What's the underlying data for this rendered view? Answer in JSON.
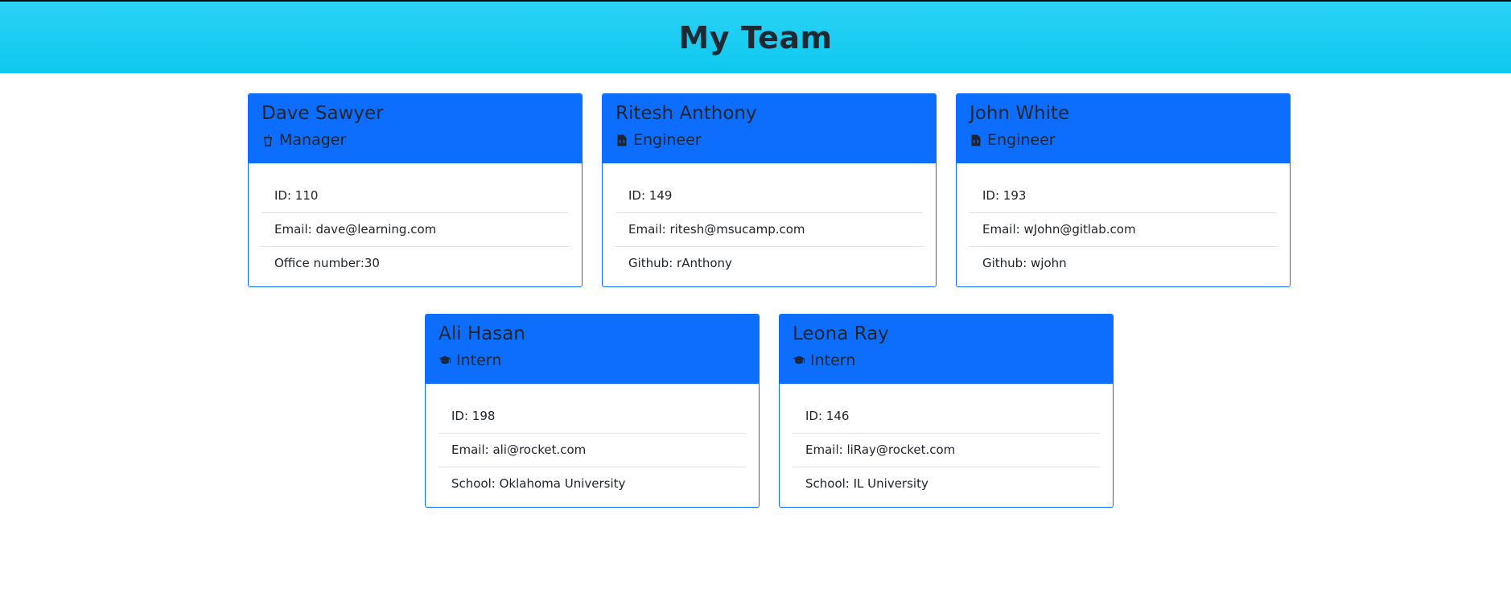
{
  "header": {
    "title": "My Team"
  },
  "team": [
    {
      "name": "Dave Sawyer",
      "role": "Manager",
      "icon": "coffee-icon",
      "details": [
        "ID: 110",
        "Email: dave@learning.com",
        "Office number:30"
      ]
    },
    {
      "name": "Ritesh Anthony",
      "role": "Engineer",
      "icon": "code-file-icon",
      "details": [
        "ID: 149",
        "Email: ritesh@msucamp.com",
        "Github: rAnthony"
      ]
    },
    {
      "name": "John White",
      "role": "Engineer",
      "icon": "code-file-icon",
      "details": [
        "ID: 193",
        "Email: wJohn@gitlab.com",
        "Github: wjohn"
      ]
    },
    {
      "name": "Ali Hasan",
      "role": "Intern",
      "icon": "graduation-cap-icon",
      "details": [
        "ID: 198",
        "Email: ali@rocket.com",
        "School: Oklahoma University"
      ]
    },
    {
      "name": "Leona Ray",
      "role": "Intern",
      "icon": "graduation-cap-icon",
      "details": [
        "ID: 146",
        "Email: liRay@rocket.com",
        "School: IL University"
      ]
    }
  ]
}
